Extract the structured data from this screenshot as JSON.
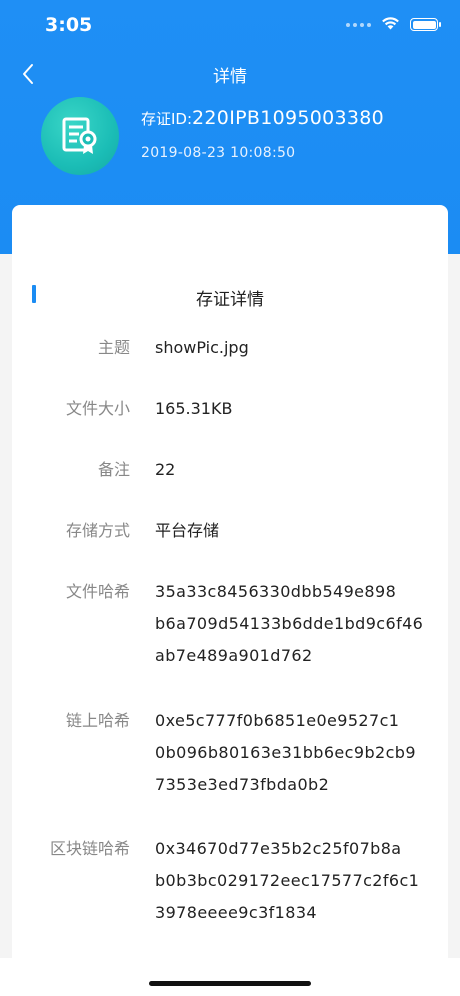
{
  "status_bar": {
    "time": "3:05"
  },
  "nav": {
    "title": "详情"
  },
  "certificate": {
    "id_label": "存证ID:",
    "id_value": "220IPB1095003380",
    "timestamp": "2019-08-23 10:08:50"
  },
  "section": {
    "title": "存证详情"
  },
  "details": {
    "subject": {
      "label": "主题",
      "value": "showPic.jpg"
    },
    "file_size": {
      "label": "文件大小",
      "value": "165.31KB"
    },
    "remark": {
      "label": "备注",
      "value": "22"
    },
    "storage": {
      "label": "存储方式",
      "value": "平台存储"
    },
    "file_hash": {
      "label": "文件哈希",
      "lines": [
        "35a33c8456330dbb549e898",
        "b6a709d54133b6dde1bd9c6f46",
        "ab7e489a901d762"
      ]
    },
    "chain_hash": {
      "label": "链上哈希",
      "lines": [
        "0xe5c777f0b6851e0e9527c1",
        "0b096b80163e31bb6ec9b2cb9",
        "7353e3ed73fbda0b2"
      ]
    },
    "block_hash": {
      "label": "区块链哈希",
      "lines": [
        "0x34670d77e35b2c25f07b8a",
        "b0b3bc029172eec17577c2f6c1",
        "3978eeee9c3f1834"
      ]
    }
  },
  "icons": {
    "back": "chevron-left-icon",
    "certificate": "certificate-document-icon",
    "wifi": "wifi-icon",
    "battery": "battery-icon"
  },
  "colors": {
    "header": "#1b8cf3",
    "accent": "#1b8cf3",
    "logo": "#1bbdb6"
  }
}
